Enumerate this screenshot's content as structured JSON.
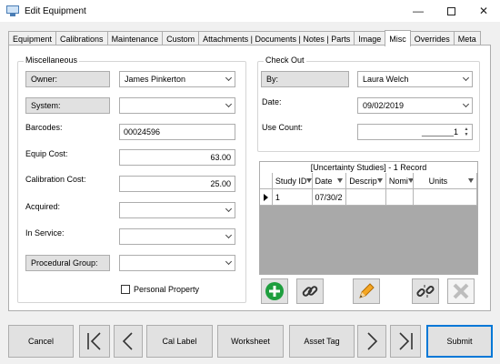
{
  "window": {
    "title": "Edit Equipment",
    "icon": "monitor-icon"
  },
  "tabs": [
    "Equipment",
    "Calibrations",
    "Maintenance",
    "Custom",
    "Attachments | Documents | Notes | Parts",
    "Image",
    "Misc",
    "Overrides",
    "Meta"
  ],
  "active_tab": "Misc",
  "misc": {
    "title": "Miscellaneous",
    "owner_label": "Owner:",
    "owner_value": "James Pinkerton",
    "system_label": "System:",
    "system_value": "",
    "barcodes_label": "Barcodes:",
    "barcodes_value": "00024596",
    "equip_cost_label": "Equip Cost:",
    "equip_cost_value": "63.00",
    "calibration_cost_label": "Calibration Cost:",
    "calibration_cost_value": "25.00",
    "acquired_label": "Acquired:",
    "acquired_value": "",
    "in_service_label": "In Service:",
    "in_service_value": "",
    "procedural_group_label": "Procedural Group:",
    "procedural_group_value": "",
    "personal_property_label": "Personal Property",
    "personal_property_checked": false
  },
  "checkout": {
    "title": "Check Out",
    "by_label": "By:",
    "by_value": "Laura Welch",
    "date_label": "Date:",
    "date_value": "09/02/2019",
    "use_count_label": "Use Count:",
    "use_count_value": "_______1"
  },
  "grid": {
    "caption": "[Uncertainty Studies] - 1 Record",
    "columns": [
      "Study ID",
      "Date",
      "Descrip",
      "Nomi",
      "Units"
    ],
    "rows": [
      [
        "1",
        "07/30/2",
        "",
        "",
        ""
      ]
    ]
  },
  "grid_buttons": [
    "add-icon",
    "link-icon",
    "edit-pencil-icon",
    "unlink-icon",
    "delete-icon"
  ],
  "bottom_buttons": {
    "cancel": "Cancel",
    "first_icon": "first-record-icon",
    "prev_icon": "previous-record-icon",
    "cal_label": "Cal Label",
    "worksheet": "Worksheet",
    "asset_tag": "Asset Tag",
    "next_icon": "next-record-icon",
    "last_icon": "last-record-icon",
    "submit": "Submit"
  },
  "colors": {
    "accent": "#0078d7",
    "add_green": "#1e9e3e",
    "pencil_orange": "#f5a623"
  }
}
